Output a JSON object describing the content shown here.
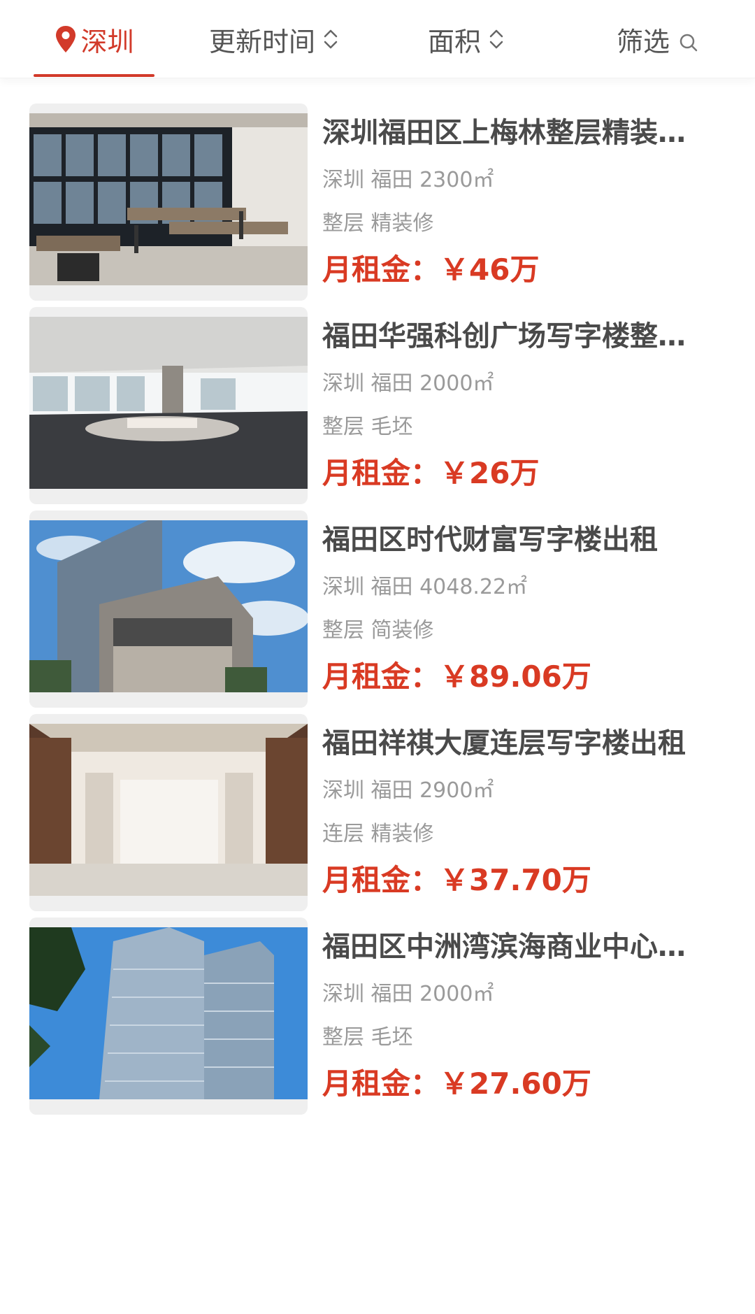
{
  "filters": {
    "city": "深圳",
    "update_time": "更新时间",
    "area": "面积",
    "screen": "筛选"
  },
  "colors": {
    "accent": "#d23a2a",
    "price": "#d93a23",
    "title": "#4a4a4a",
    "meta": "#9a9a9a"
  },
  "listings": [
    {
      "title": "深圳福田区上梅林整层精装修写字楼出租",
      "location": "深圳 福田 2300㎡",
      "tags": "整层 精装修",
      "price_label": "月租金：",
      "price_value": "￥46万",
      "image": "office-interior-desks"
    },
    {
      "title": "福田华强科创广场写字楼整层出租",
      "location": "深圳 福田 2000㎡",
      "tags": "整层 毛坯",
      "price_label": "月租金：",
      "price_value": "￥26万",
      "image": "open-office-floor"
    },
    {
      "title": "福田区时代财富写字楼出租",
      "location": "深圳 福田 4048.22㎡",
      "tags": "整层 简装修",
      "price_label": "月租金：",
      "price_value": "￥89.06万",
      "image": "tower-building-exterior"
    },
    {
      "title": "福田祥祺大厦连层写字楼出租",
      "location": "深圳 福田 2900㎡",
      "tags": "连层 精装修",
      "price_label": "月租金：",
      "price_value": "￥37.70万",
      "image": "elevator-lobby"
    },
    {
      "title": "福田区中洲湾滨海商业中心写字楼出租",
      "location": "深圳 福田 2000㎡",
      "tags": "整层 毛坯",
      "price_label": "月租金：",
      "price_value": "￥27.60万",
      "image": "glass-twin-towers"
    }
  ]
}
